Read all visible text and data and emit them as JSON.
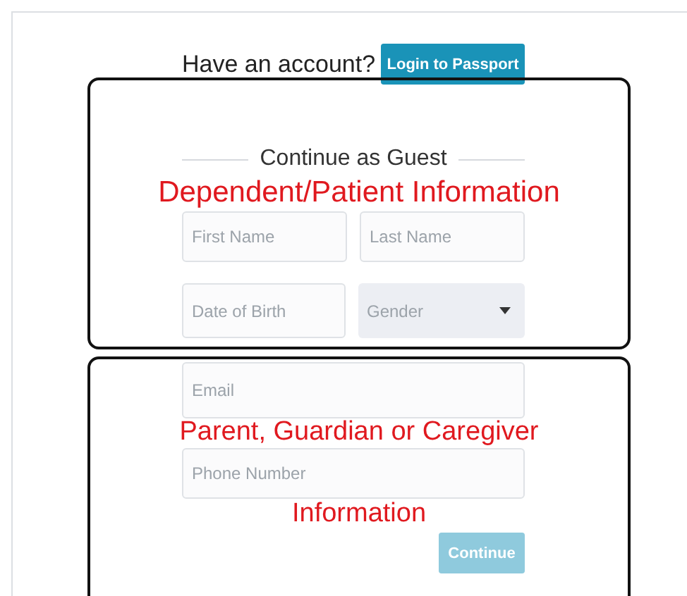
{
  "header": {
    "prompt": "Have an account?",
    "login_button": "Login to Passport"
  },
  "guest_section": {
    "title": "Continue as Guest"
  },
  "fields": [
    [
      {
        "kind": "text",
        "placeholder": "First Name"
      },
      {
        "kind": "text",
        "placeholder": "Last Name"
      }
    ],
    [
      {
        "kind": "text",
        "placeholder": "Date of Birth"
      },
      {
        "kind": "select",
        "placeholder": "Gender"
      }
    ],
    [
      {
        "kind": "text",
        "placeholder": "Email"
      }
    ],
    [
      {
        "kind": "text",
        "placeholder": "Phone Number"
      }
    ]
  ],
  "continue_button": {
    "label": "Continue",
    "disabled": true
  },
  "annotations": [
    {
      "lines": [
        "Dependent/Patient Information"
      ]
    },
    {
      "lines": [
        "Parent, Guardian or Caregiver",
        "Information"
      ]
    }
  ]
}
